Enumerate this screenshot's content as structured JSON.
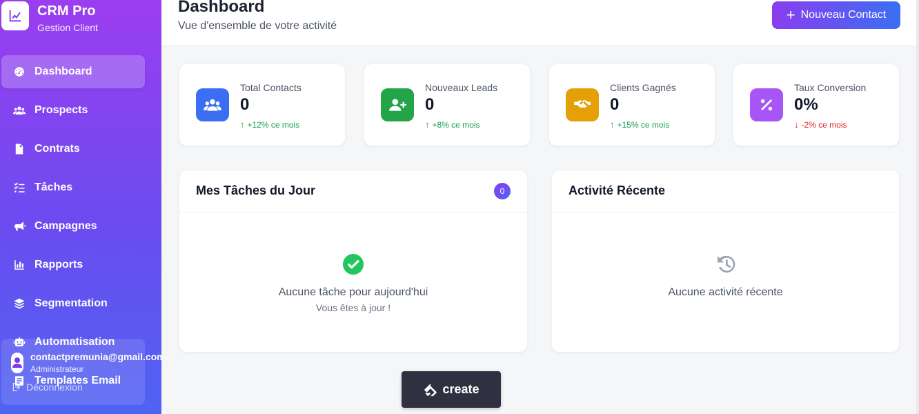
{
  "brand": {
    "title": "CRM Pro",
    "subtitle": "Gestion Client",
    "icon": "chart-line-icon"
  },
  "nav": {
    "items": [
      {
        "label": "Dashboard",
        "icon": "gauge-icon",
        "active": true
      },
      {
        "label": "Prospects",
        "icon": "users-icon"
      },
      {
        "label": "Contrats",
        "icon": "file-contract-icon"
      },
      {
        "label": "Tâches",
        "icon": "tasks-icon"
      },
      {
        "label": "Campagnes",
        "icon": "bullhorn-icon"
      },
      {
        "label": "Rapports",
        "icon": "chart-bar-icon"
      },
      {
        "label": "Segmentation",
        "icon": "layers-icon"
      },
      {
        "label": "Automatisation",
        "icon": "robot-icon"
      },
      {
        "label": "Templates Email",
        "icon": "envelope-icon"
      }
    ]
  },
  "user": {
    "email": "contactpremunia@gmail.com",
    "role": "Administrateur",
    "logout": "Déconnexion"
  },
  "header": {
    "title": "Dashboard",
    "subtitle": "Vue d'ensemble de votre activité",
    "new_contact_label": "Nouveau Contact"
  },
  "stats": [
    {
      "label": "Total Contacts",
      "value": "0",
      "trend": "+12% ce mois",
      "direction": "up",
      "color": "#3b6ef2",
      "icon": "users-icon"
    },
    {
      "label": "Nouveaux Leads",
      "value": "0",
      "trend": "+8% ce mois",
      "direction": "up",
      "color": "#22a447",
      "icon": "user-plus-icon"
    },
    {
      "label": "Clients Gagnés",
      "value": "0",
      "trend": "+15% ce mois",
      "direction": "up",
      "color": "#e5a008",
      "icon": "handshake-icon"
    },
    {
      "label": "Taux Conversion",
      "value": "0%",
      "trend": "-2% ce mois",
      "direction": "down",
      "color": "#a855f7",
      "icon": "percent-icon"
    }
  ],
  "tasks_panel": {
    "title": "Mes Tâches du Jour",
    "count": "0",
    "empty_text": "Aucune tâche pour aujourd'hui",
    "empty_sub": "Vous êtes à jour !"
  },
  "activity_panel": {
    "title": "Activité Récente",
    "empty_text": "Aucune activité récente"
  },
  "create_button": {
    "label": "create"
  }
}
